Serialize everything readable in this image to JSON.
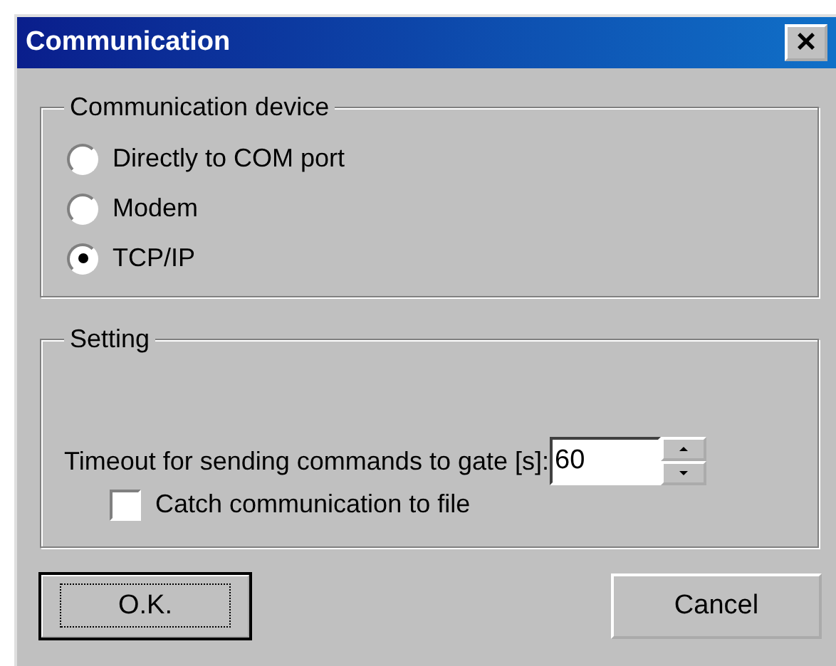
{
  "window": {
    "title": "Communication",
    "close": "×"
  },
  "device_group": {
    "title": "Communication device",
    "options": [
      {
        "label": "Directly to COM port",
        "selected": false
      },
      {
        "label": "Modem",
        "selected": false
      },
      {
        "label": "TCP/IP",
        "selected": true
      }
    ]
  },
  "setting_group": {
    "title": "Setting",
    "timeout": {
      "label": "Timeout for sending commands to gate [s]:",
      "value": "60"
    },
    "catch": {
      "label": "Catch communication to file",
      "checked": false
    }
  },
  "buttons": [
    {
      "label": "O.K.",
      "default": true
    },
    {
      "label": "Cancel",
      "default": false
    }
  ]
}
